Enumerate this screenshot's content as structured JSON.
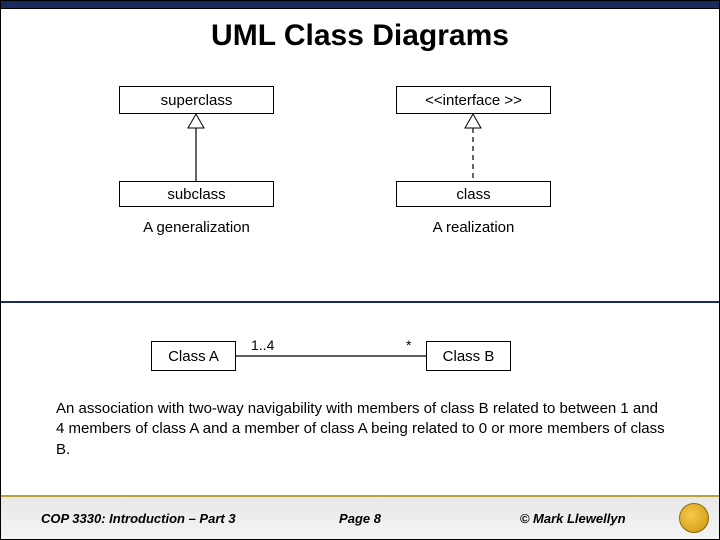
{
  "title": "UML Class Diagrams",
  "top": {
    "left": {
      "upper": "superclass",
      "lower": "subclass",
      "caption": "A generalization"
    },
    "right": {
      "upper": "<<interface >>",
      "lower": "class",
      "caption": "A realization"
    }
  },
  "assoc": {
    "leftBox": "Class A",
    "rightBox": "Class B",
    "multLeft": "1..4",
    "multRight": "*",
    "description": "An association with two-way navigability with members of class B related to between 1 and 4 members of class A and a member of class A being related to 0 or more members of class B."
  },
  "footer": {
    "course": "COP 3330: Introduction – Part 3",
    "page": "Page 8",
    "copyright": "© Mark Llewellyn"
  },
  "colors": {
    "navy": "#1a2a5c",
    "gold": "#b8a23a"
  }
}
